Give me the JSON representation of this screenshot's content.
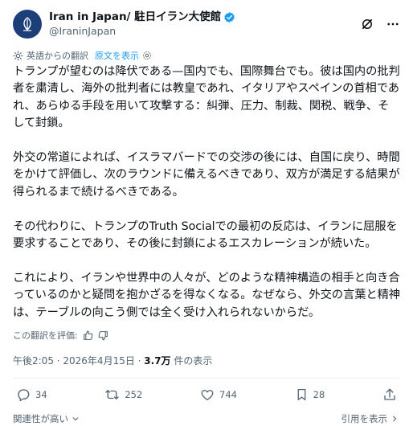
{
  "account": {
    "display_name": "Iran in Japan/ 駐日イラン大使館",
    "handle": "@IraninJapan"
  },
  "translation": {
    "label": "英語からの翻訳",
    "show_original": "原文を表示"
  },
  "post": {
    "paragraphs": [
      "トランプが望むのは降伏である—国内でも、国際舞台でも。彼は国内の批判者を粛清し、海外の批判者には教皇であれ、イタリアやスペインの首相であれ、あらゆる手段を用いて攻撃する：糾弾、圧力、制裁、関税、戦争、そして封鎖。",
      "外交の常道によれば、イスラマバードでの交渉の後には、自国に戻り、時間をかけて評価し、次のラウンドに備えるべきであり、双方が満足する結果が得られるまで続けるべきである。",
      "その代わりに、トランプのTruth Socialでの最初の反応は、イランに屈服を要求することであり、その後に封鎖によるエスカレーションが続いた。",
      "これにより、イランや世界中の人々が、どのような精神構造の相手と向き合っているのかと疑問を抱かざるを得なくなる。なぜなら、外交の言葉と精神は、テーブルの向こう側では全く受け入れられないからだ。"
    ],
    "rate_label": "この翻訳を評価:",
    "timestamp": "午後2:05 · 2026年4月15日 · ",
    "views_count": "3.7万",
    "views_label": " 件の表示"
  },
  "actions": {
    "replies": "34",
    "reposts": "252",
    "likes": "744",
    "bookmarks": "28"
  },
  "footer": {
    "most_relevant": "関連性が高い",
    "view_quotes": "引用を表示"
  },
  "colors": {
    "accent": "#1d9bf0",
    "text": "#0f1419",
    "muted": "#536471"
  },
  "icons": [
    "verified-badge-icon",
    "grok-icon",
    "more-icon",
    "translate-gear-icon",
    "thumbs-up-icon",
    "thumbs-down-icon",
    "reply-icon",
    "repost-icon",
    "like-icon",
    "bookmark-icon",
    "share-icon",
    "chevron-down-icon",
    "chevron-right-icon"
  ]
}
